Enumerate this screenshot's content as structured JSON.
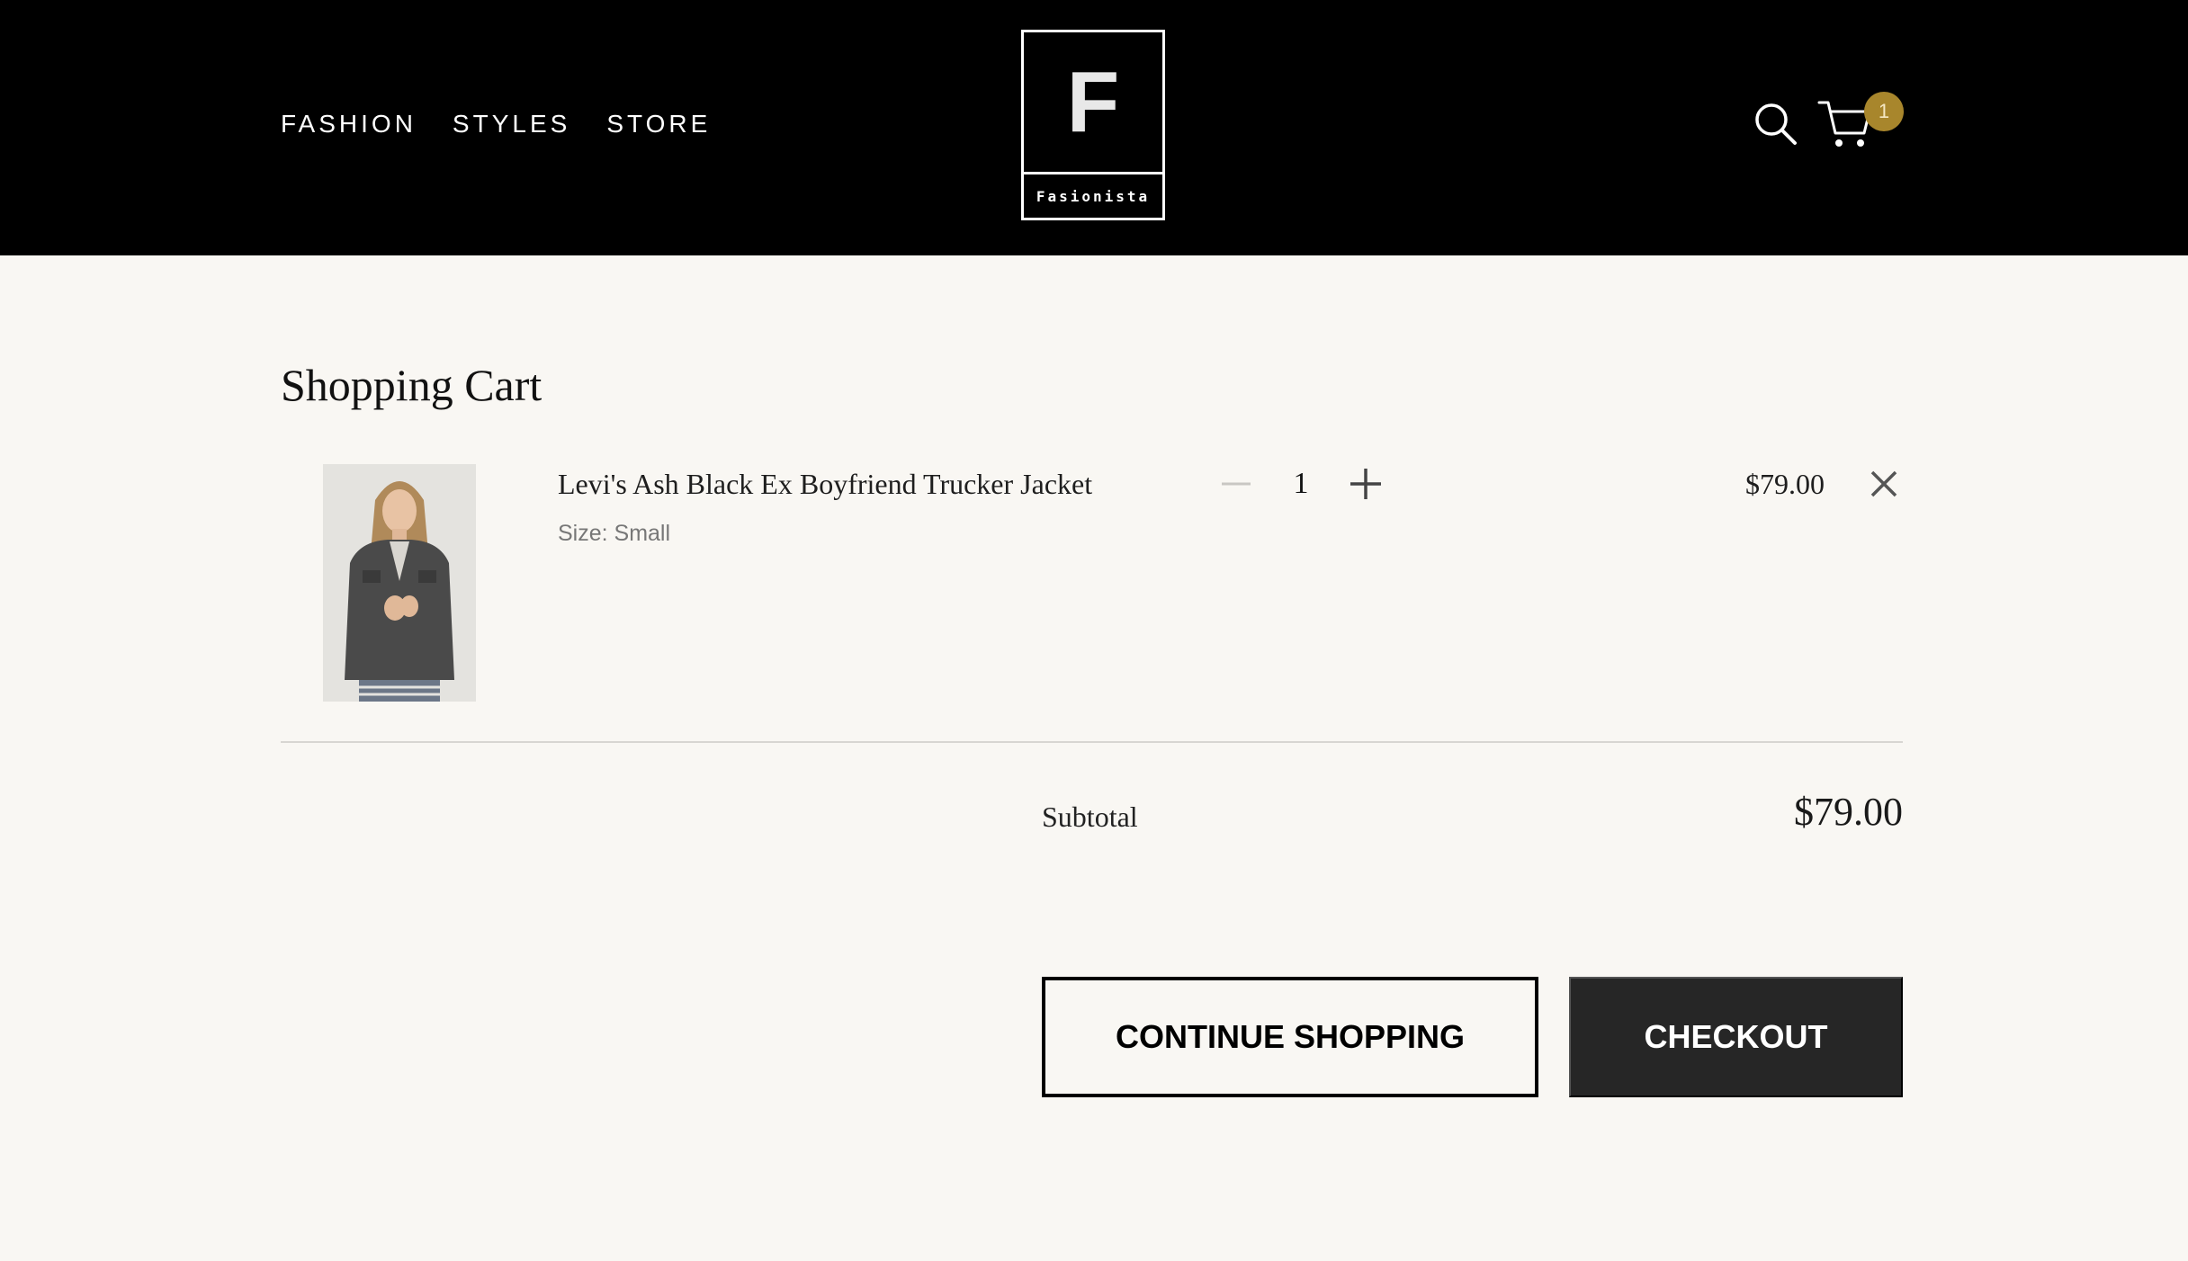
{
  "header": {
    "nav": [
      "FASHION",
      "STYLES",
      "STORE"
    ],
    "logo_letter": "F",
    "logo_word": "Fasionista",
    "search_icon": "search-icon",
    "cart_icon": "cart-icon",
    "cart_count": "1",
    "badge_color": "#a8862c"
  },
  "cart": {
    "title": "Shopping Cart",
    "items": [
      {
        "name": "Levi's Ash Black Ex Boyfriend Trucker Jacket",
        "size": "Size: Small",
        "quantity": "1",
        "price": "$79.00"
      }
    ],
    "subtotal_label": "Subtotal",
    "subtotal_value": "$79.00",
    "continue_label": "CONTINUE SHOPPING",
    "checkout_label": "CHECKOUT"
  },
  "colors": {
    "header_bg": "#000000",
    "page_bg": "#f9f7f3",
    "checkout_bg": "#262626"
  }
}
